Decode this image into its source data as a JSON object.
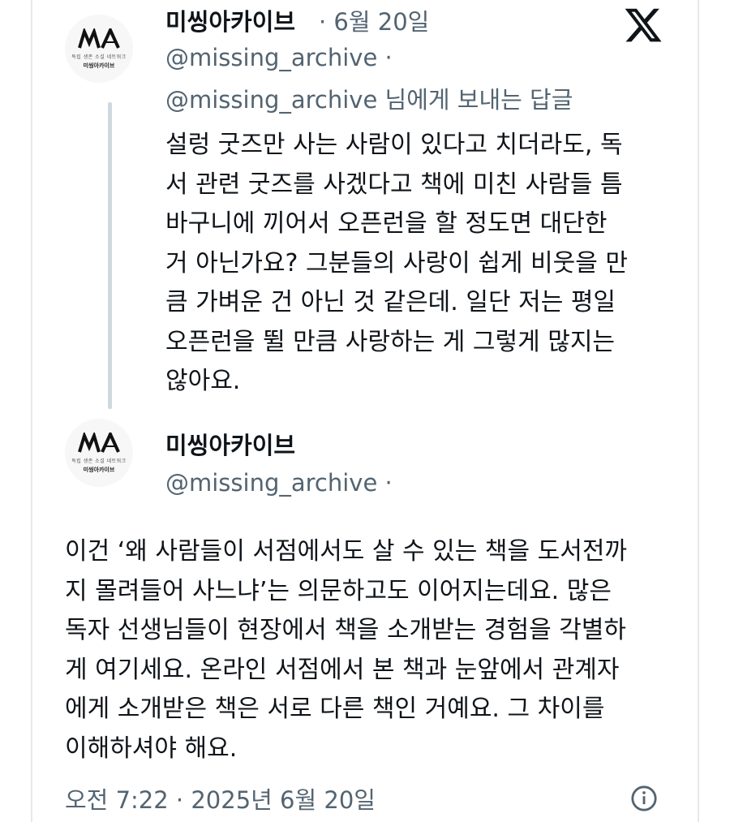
{
  "tweet1": {
    "display_name": "미씽아카이브",
    "date": "· 6월 20일",
    "handle": "@missing_archive ·",
    "reply_to": "@missing_archive 님에게 보내는 답글",
    "text": "설렁 굿즈만 사는 사람이 있다고 치더라도, 독\n서 관련 굿즈를 사겠다고 책에 미친 사람들 틈\n바구니에 끼어서 오픈런을 할 정도면 대단한\n거 아닌가요? 그분들의 사랑이 쉽게 비웃을 만\n큼 가벼운 건 아닌 것 같은데. 일단 저는 평일\n오픈런을 뛸 만큼 사랑하는 게 그렇게 많지는\n않아요."
  },
  "tweet2": {
    "display_name": "미씽아카이브",
    "handle": "@missing_archive ·",
    "text": "이건 ‘왜 사람들이 서점에서도 살 수 있는 책을 도서전까\n지 몰려들어 사느냐’는 의문하고도 이어지는데요. 많은\n독자 선생님들이 현장에서 책을 소개받는 경험을 각별하\n게 여기세요. 온라인 서점에서 본 책과 눈앞에서 관계자\n에게 소개받은 책은 서로 다른 책인 거예요. 그 차이를\n이해하셔야 해요.",
    "timestamp": "오전 7:22 · 2025년 6월 20일"
  },
  "avatar": {
    "mark": "MA",
    "subtitle": "독립 생존 소설 네트워크",
    "name": "미씽아카이브"
  },
  "icons": {
    "brand": "x-logo-icon",
    "info": "info-icon"
  },
  "colors": {
    "text": "#0f1419",
    "secondary": "#536471",
    "thread_line": "#cfd9de"
  }
}
